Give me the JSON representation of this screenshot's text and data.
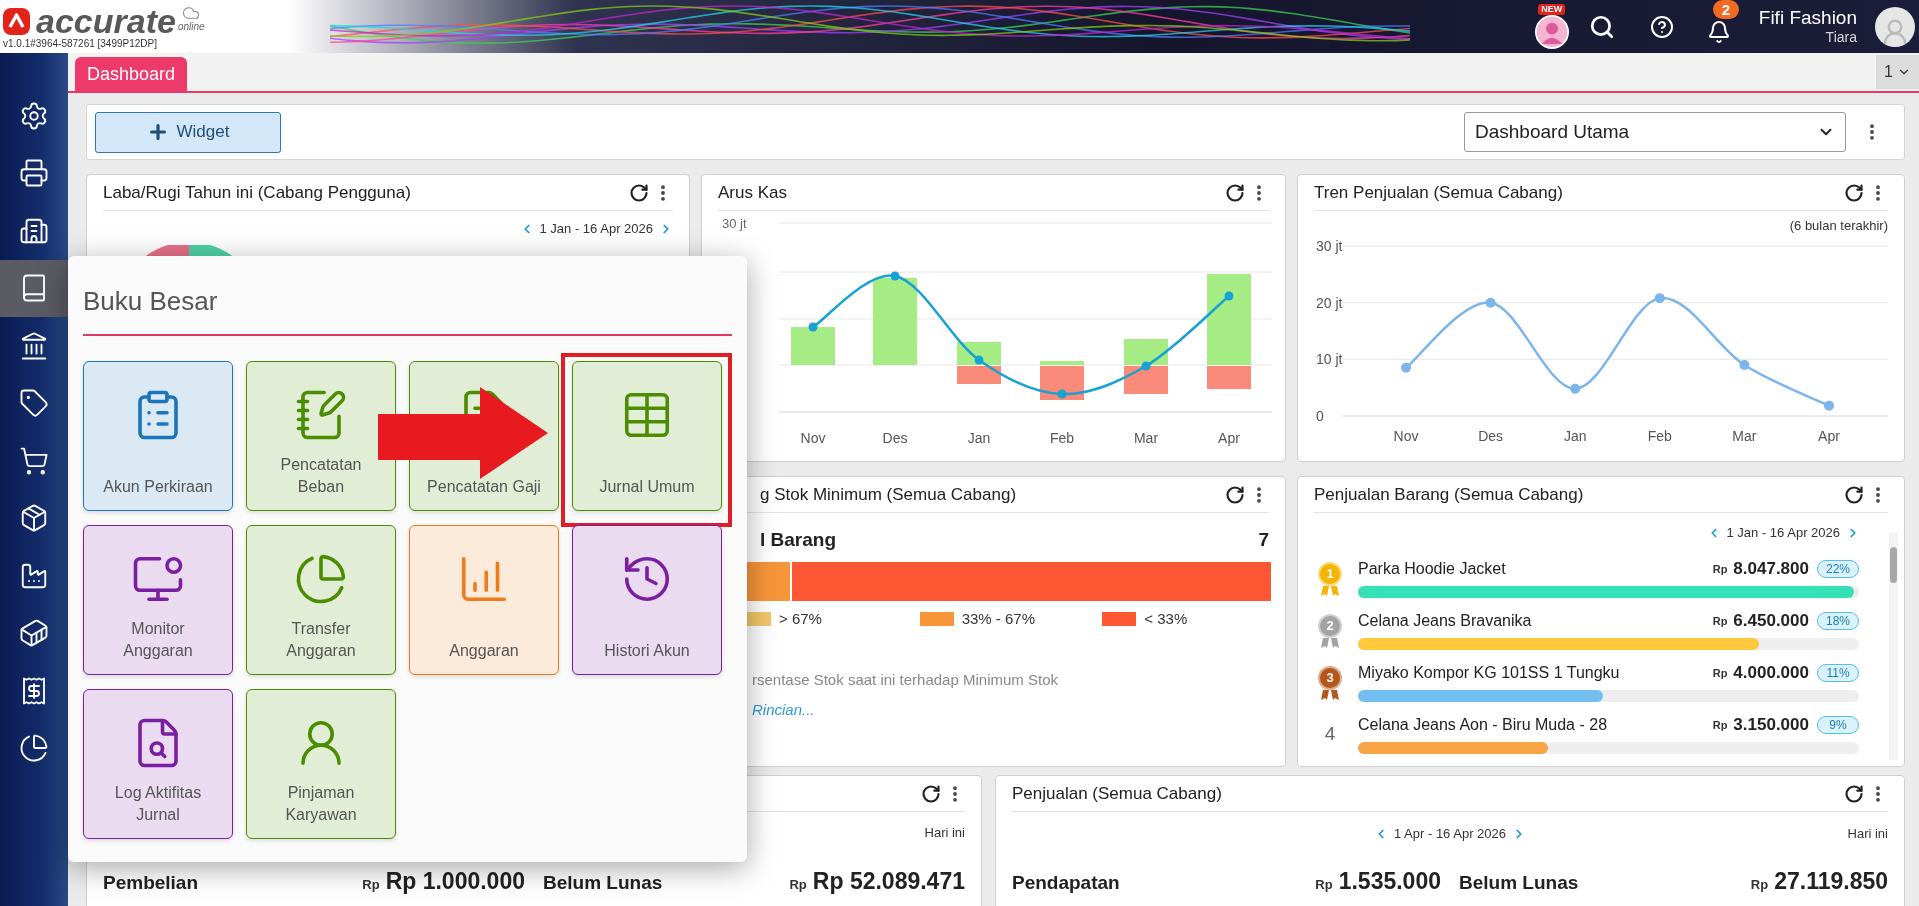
{
  "app": {
    "logo_text": "accurate",
    "logo_sub": "online",
    "version": "v1.0.1#3964-587261 [3499P12DP]"
  },
  "header": {
    "new_badge": "NEW",
    "notification_count": "2",
    "user_name": "Fifi Fashion",
    "user_sub": "Tiara"
  },
  "sidebar": {
    "items": [
      {
        "selected": false
      },
      {
        "selected": false
      },
      {
        "selected": false
      },
      {
        "selected": true
      },
      {
        "selected": false
      },
      {
        "selected": false
      },
      {
        "selected": false
      },
      {
        "selected": false
      },
      {
        "selected": false
      },
      {
        "selected": false
      },
      {
        "selected": false
      },
      {
        "selected": false
      }
    ]
  },
  "tabs": [
    {
      "label": "Dashboard",
      "selected": true
    }
  ],
  "tab_page": "1",
  "toolbar": {
    "add_button": "Widget",
    "dashboard_select": "Dashboard Utama"
  },
  "laba_rugi": {
    "title": "Laba/Rugi Tahun ini (Cabang Pengguna)",
    "date_range": "1 Jan - 16 Apr 2026"
  },
  "arus_kas": {
    "title": "Arus Kas",
    "y_axis_top": "30 jt",
    "months": [
      "Nov",
      "Des",
      "Jan",
      "Feb",
      "Mar",
      "Apr"
    ]
  },
  "tren_penjualan": {
    "title": "Tren Penjualan (Semua Cabang)",
    "note": "(6 bulan terakhir)",
    "chart_data": {
      "type": "line",
      "categories": [
        "Nov",
        "Des",
        "Jan",
        "Feb",
        "Mar",
        "Apr"
      ],
      "series": [
        {
          "color": "#7cb5ec",
          "marker": true,
          "values": [
            8.5,
            20,
            4.8,
            20.8,
            9,
            1.8
          ]
        }
      ],
      "ylim": [
        0,
        30
      ],
      "yticks": [
        {
          "value": 0,
          "label": "0"
        },
        {
          "value": 10,
          "label": "10 jt"
        },
        {
          "value": 20,
          "label": "20 jt"
        },
        {
          "value": 30,
          "label": "30 jt"
        }
      ]
    }
  },
  "stok_minimum": {
    "title": "g Stok Minimum (Semua Cabang)",
    "label": "l Barang",
    "count": "7",
    "segments": [
      {
        "color": "#f7953a",
        "level": 0.13
      },
      {
        "color": "#ff5733",
        "level": 0.87
      }
    ],
    "legend": [
      {
        "color": "#f3c76a",
        "label": "> 67%"
      },
      {
        "color": "#f7953a",
        "label": "33% - 67%"
      },
      {
        "color": "#ff5733",
        "label": "< 33%"
      }
    ],
    "note": "rsentase Stok saat ini terhadap Minimum Stok",
    "link": "Rincian..."
  },
  "penjualan_barang": {
    "title": "Penjualan Barang (Semua Cabang)",
    "date_range": "1 Jan - 16 Apr 2026",
    "items": [
      {
        "rank": "1",
        "medal": {
          "color": "#f5b400"
        },
        "name": "Parka Hoodie Jacket",
        "currency": "Rp",
        "amount": "8.047.800",
        "percent": "22%",
        "level": 0.99,
        "color": "#34e0b4"
      },
      {
        "rank": "2",
        "medal": {
          "color": "#a3a3a3"
        },
        "name": "Celana Jeans Bravanika",
        "currency": "Rp",
        "amount": "6.450.000",
        "percent": "18%",
        "level": 0.8,
        "color": "#ffc83d"
      },
      {
        "rank": "3",
        "medal": {
          "color": "#b5561a"
        },
        "name": "Miyako Kompor KG 101SS 1 Tungku",
        "currency": "Rp",
        "amount": "4.000.000",
        "percent": "11%",
        "level": 0.49,
        "color": "#74bdf0"
      },
      {
        "rank": "4",
        "name": "Celana Jeans Aon - Biru Muda - 28",
        "currency": "Rp",
        "amount": "3.150.000",
        "percent": "9%",
        "level": 0.38,
        "color": "#f7a544"
      }
    ]
  },
  "pembelian": {
    "period": "Hari ini",
    "stats": [
      {
        "label": "Pembelian",
        "currency": "Rp",
        "amount": "Rp 1.000.000"
      },
      {
        "label": "Belum Lunas",
        "currency": "Rp",
        "amount": "Rp 52.089.471"
      }
    ]
  },
  "penjualan": {
    "title": "Penjualan (Semua Cabang)",
    "date_range": "1 Apr - 16 Apr 2026",
    "period": "Hari ini",
    "stats": [
      {
        "label": "Pendapatan",
        "currency": "Rp",
        "amount": "1.535.000"
      },
      {
        "label": "Belum Lunas",
        "currency": "Rp",
        "amount": "27.119.850"
      }
    ]
  },
  "popup": {
    "title": "Buku Besar",
    "arrow": true,
    "tiles": [
      {
        "label": "Akun Perkiraan",
        "color": "#1b75bb",
        "highlighted": false
      },
      {
        "label": "Pencatatan Beban",
        "color": "#4c8c00",
        "highlighted": false
      },
      {
        "label": "Pencatatan Gaji",
        "color": "#4c8c00",
        "highlighted": false
      },
      {
        "label": "Jurnal Umum",
        "color": "#4c8c00",
        "highlighted": true
      },
      {
        "label": "Monitor Anggaran",
        "color": "#7b1fa2",
        "highlighted": false
      },
      {
        "label": "Transfer Anggaran",
        "color": "#4c8c00",
        "highlighted": false
      },
      {
        "label": "Anggaran",
        "color": "#ef7c1b",
        "highlighted": false
      },
      {
        "label": "Histori Akun",
        "color": "#7b1fa2",
        "highlighted": false
      },
      {
        "label": "Log Aktifitas Jurnal",
        "color": "#7b1fa2",
        "highlighted": false
      },
      {
        "label": "Pinjaman Karyawan",
        "color": "#4c8c00",
        "highlighted": false
      }
    ]
  }
}
